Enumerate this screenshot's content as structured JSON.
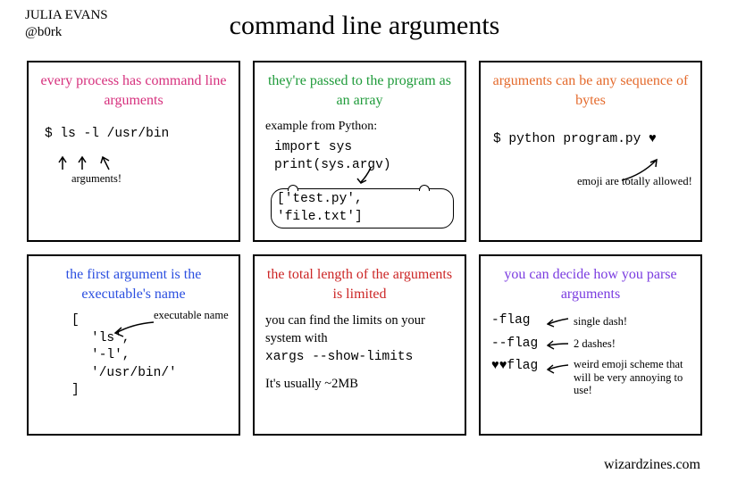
{
  "author": {
    "name": "JULIA EVANS",
    "handle": "@b0rk"
  },
  "title": "command line arguments",
  "footer": "wizardzines.com",
  "panels": {
    "p1": {
      "title": "every process has command line arguments",
      "cmd": "$ ls -l /usr/bin",
      "note": "arguments!"
    },
    "p2": {
      "title": "they're passed to the program as an array",
      "sub": "example from Python:",
      "line1": "import sys",
      "line2": "print(sys.argv)",
      "output": "['test.py', 'file.txt']"
    },
    "p3": {
      "title": "arguments can be any sequence of bytes",
      "cmd": "$ python program.py ♥",
      "note": "emoji are totally allowed!"
    },
    "p4": {
      "title": "the first argument is the executable's name",
      "bracket_open": "[",
      "item1": "'ls',",
      "item2": "'-l',",
      "item3": "'/usr/bin/'",
      "bracket_close": "]",
      "note": "executable name"
    },
    "p5": {
      "title": "the total length of the arguments is limited",
      "line1": "you can find the limits on your system with",
      "cmd": "xargs --show-limits",
      "line2": "It's usually ~2MB"
    },
    "p6": {
      "title": "you can decide how you parse arguments",
      "flag1": "-flag",
      "note1": "single dash!",
      "flag2": "--flag",
      "note2": "2 dashes!",
      "flag3": "♥♥flag",
      "note3": "weird emoji scheme that will be very annoying to use!"
    }
  }
}
